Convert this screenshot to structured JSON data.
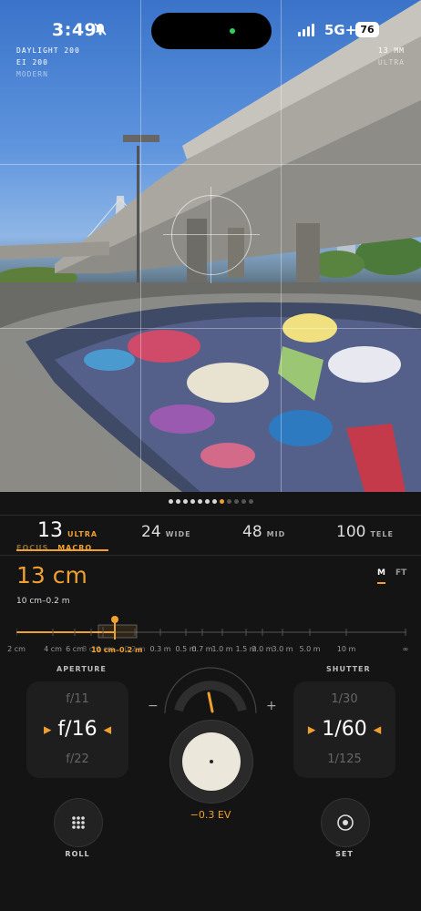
{
  "status_bar": {
    "time": "3:49",
    "network": "5G+",
    "battery": "76"
  },
  "camera_info": {
    "film": "DAYLIGHT 200",
    "ei": "EI 200",
    "mode": "MODERN",
    "focal_length": "13 MM",
    "lens_name": "ULTRA"
  },
  "lenses": [
    {
      "num": "13",
      "label": "ULTRA"
    },
    {
      "num": "24",
      "label": "WIDE"
    },
    {
      "num": "48",
      "label": "MID"
    },
    {
      "num": "100",
      "label": "TELE"
    }
  ],
  "focus": {
    "label_focus": "FOCUS",
    "label_macro": "MACRO",
    "value": "13 cm",
    "range": "10 cm–0.2 m",
    "unit_m": "M",
    "unit_ft": "FT",
    "scale_ticks": [
      "2 cm",
      "4 cm",
      "6 cm",
      "8 cm",
      "10 cm",
      "0.2 m",
      "0.3 m",
      "0.5 m",
      "0.7 m",
      "1.0 m",
      "1.5 m",
      "2.0 m",
      "3.0 m",
      "5.0 m",
      "10 m",
      "∞"
    ],
    "selected_range_label": "10 cm–0.2 m"
  },
  "aperture": {
    "title": "APERTURE",
    "prev": "f/11",
    "current": "f/16",
    "next": "f/22"
  },
  "shutter": {
    "title": "SHUTTER",
    "prev": "1/30",
    "current": "1/60",
    "next": "1/125"
  },
  "exposure": {
    "minus": "−",
    "plus": "+",
    "ev": "−0.3 EV"
  },
  "buttons": {
    "roll": "ROLL",
    "set": "SET"
  },
  "colors": {
    "accent": "#f0a030",
    "background": "#141414"
  }
}
